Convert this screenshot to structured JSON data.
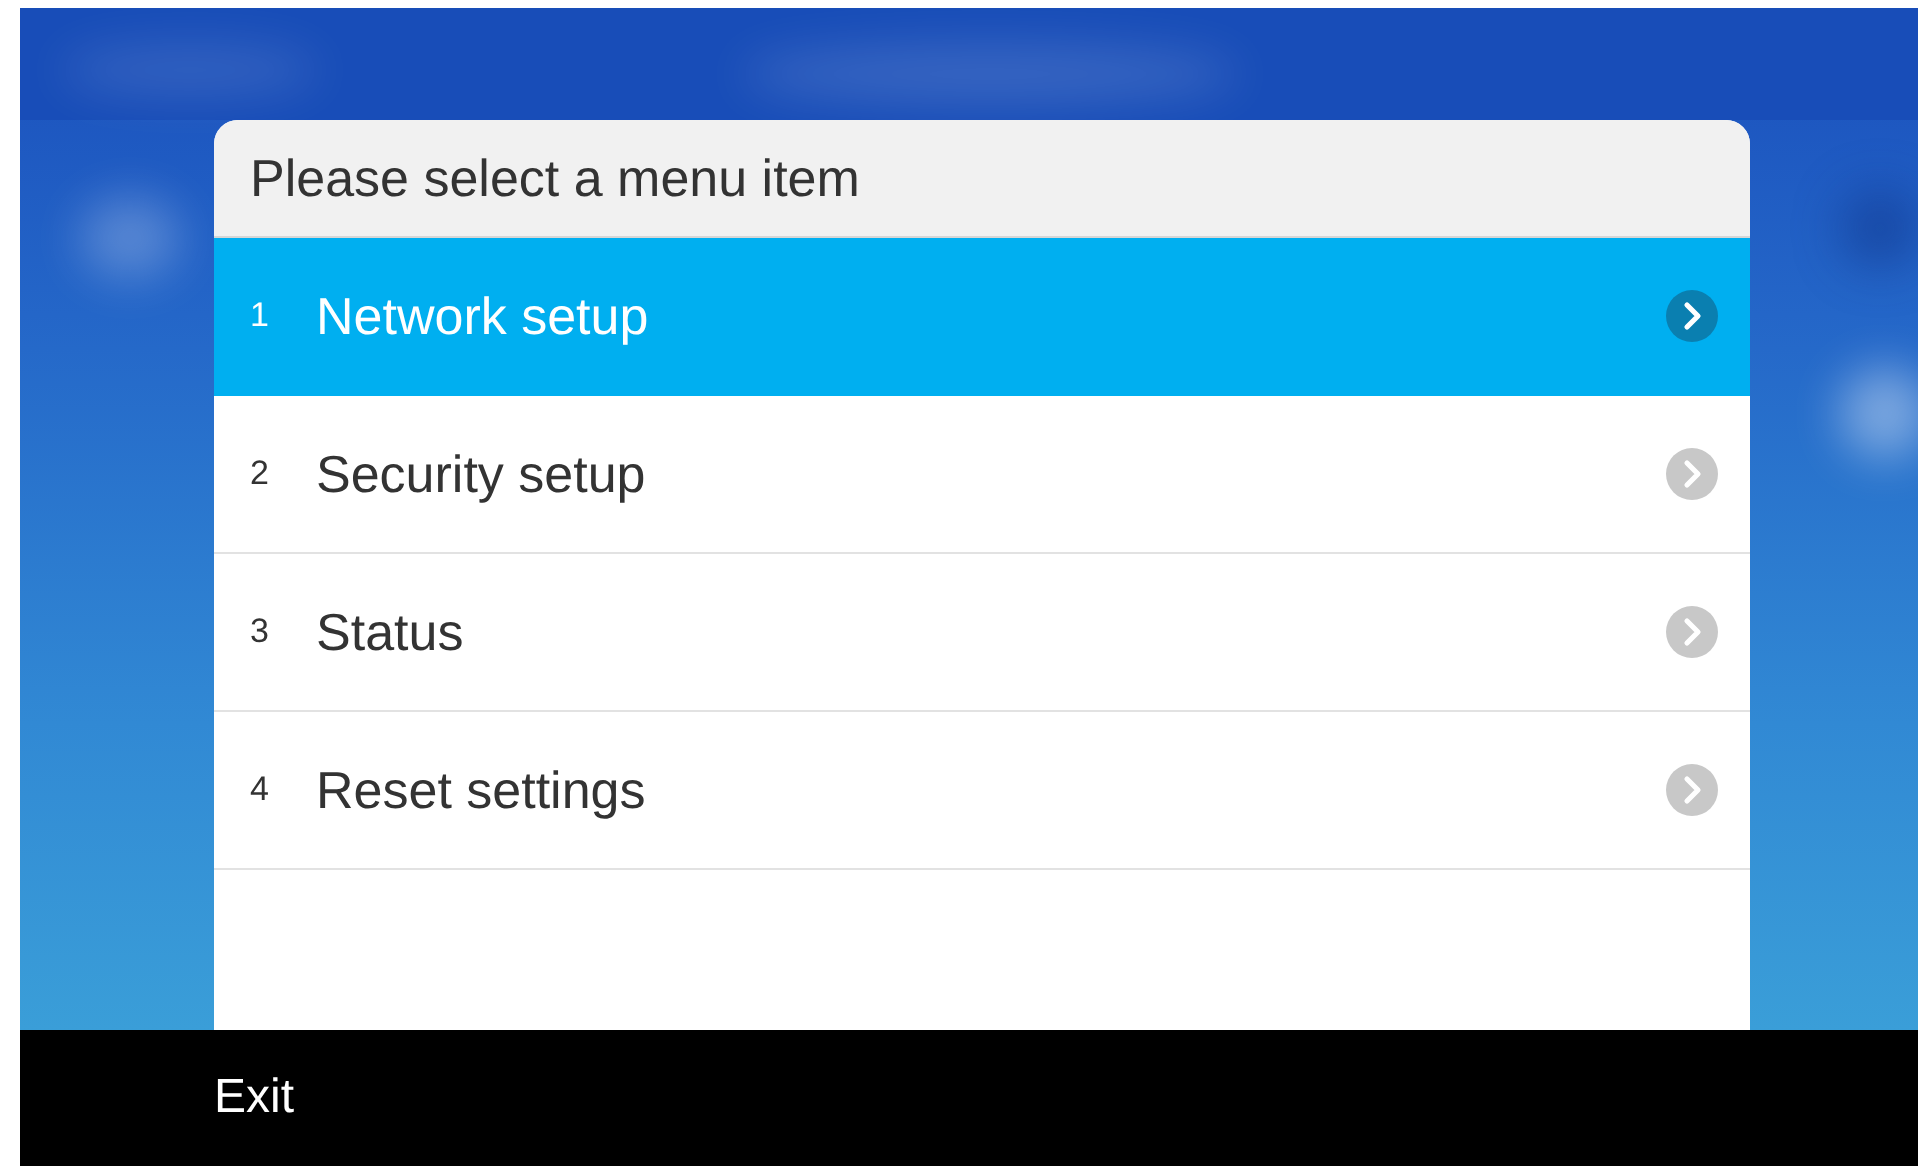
{
  "dialog": {
    "title": "Please select a menu item",
    "items": [
      {
        "number": "1",
        "label": "Network setup",
        "selected": true
      },
      {
        "number": "2",
        "label": "Security setup",
        "selected": false
      },
      {
        "number": "3",
        "label": "Status",
        "selected": false
      },
      {
        "number": "4",
        "label": "Reset settings",
        "selected": false
      }
    ]
  },
  "bottom_bar": {
    "button": "Exit"
  }
}
